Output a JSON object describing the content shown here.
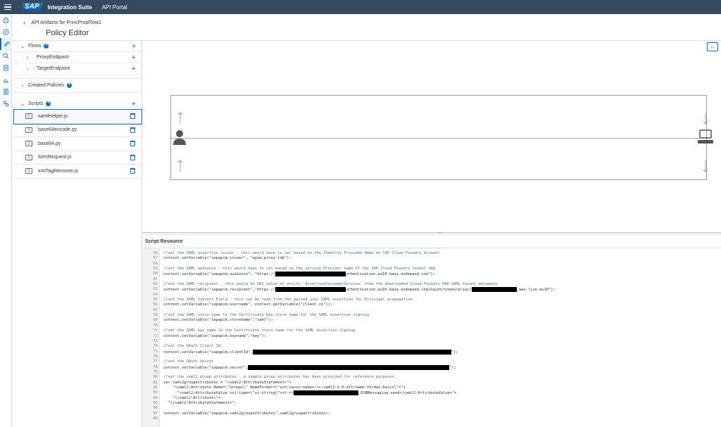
{
  "shellbar": {
    "logo": "SAP",
    "product": "Integration Suite",
    "area": "API Portal"
  },
  "leftnav": {
    "items": [
      "home-icon",
      "discover-icon",
      "design-icon",
      "test-icon",
      "configure-icon",
      "monitor-icon",
      "analyze-icon",
      "settings-icon"
    ]
  },
  "header": {
    "breadcrumb": "API Artifacts for PrincPropFlow1",
    "title": "Policy Editor"
  },
  "sidebar": {
    "flows": {
      "label": "Flows",
      "children": [
        "ProxyEndpoint",
        "TargetEndpoint"
      ]
    },
    "created_policies": {
      "label": "Created Policies"
    },
    "scripts": {
      "label": "Scripts",
      "items": [
        "samlHelper.js",
        "base64encode.py",
        "base64.py",
        "formRequest.js",
        "xmlTagRemover.js"
      ],
      "selected_index": 0
    }
  },
  "editor": {
    "title": "Script Resource",
    "lines": [
      {
        "n": "56",
        "t": "//set the SAML assertion issuer - this would have to set based on the Identity Provided Name on SAP Cloud Foundry Account",
        "c": true
      },
      {
        "n": "57",
        "t": "context.setVariable(\"sapapim.issuer\", \"apim.proxy.idp\");"
      },
      {
        "n": "58",
        "t": ""
      },
      {
        "n": "59",
        "t": "//set the SAML audience - this would have to set based on the service Provider name of the SAP Cloud Foundry tenant UAA",
        "c": true
      },
      {
        "n": "60",
        "t": "context.setVariable(\"sapapim.audience\", \"https://",
        "r": 100,
        "t2": "uthentication.eu10.hana.ondemand.com\");"
      },
      {
        "n": "61",
        "t": ""
      },
      {
        "n": "62",
        "t": "//set the SAML recipient - this would be URI value of entity 'AssertionConsumerService' from the downloaded Cloud Foundry UAA SAML tenant metadata",
        "c": true
      },
      {
        "n": "63",
        "t": "context.setVariable(\"sapapim.recipient\",\"https://",
        "r": 100,
        "t2": "uthentication.eu10.hana.ondemand.com/oauth/token/alias/",
        "r2": 64,
        "t3": ".aws-live-eu10\");"
      },
      {
        "n": "64",
        "t": ""
      },
      {
        "n": "65",
        "t": "//set the SAML Subject Field - this can be read from the passed user SAML assertion for Principal propagation",
        "c": true
      },
      {
        "n": "66",
        "t": "context.setVariable(\"sapapim.username\", context.getVariable(\"client.cn\"));"
      },
      {
        "n": "67",
        "t": ""
      },
      {
        "n": "68",
        "t": "//set the SAML store name to the Certificate Key store name for the SAML assertion signing",
        "c": true
      },
      {
        "n": "69",
        "t": "context.setVariable(\"sapapim.storename\",\"saml\");"
      },
      {
        "n": "70",
        "t": ""
      },
      {
        "n": "71",
        "t": "//set the SAML key name to the Certificate store name for the SAML assertion signing",
        "c": true
      },
      {
        "n": "72",
        "t": "context.setVariable(\"sapapim.keyname\",\"key\");"
      },
      {
        "n": "73",
        "t": ""
      },
      {
        "n": "74",
        "t": "//set the OAuth Client Id",
        "c": true
      },
      {
        "n": "75",
        "t": "context.setVariable(\"sapapim.clientId\",",
        "r": 282,
        "t2": "\");"
      },
      {
        "n": "76",
        "t": ""
      },
      {
        "n": "77",
        "t": "//set the OAuth Secret",
        "c": true
      },
      {
        "n": "78",
        "t": "context.setVariable(\"sapapim.secret\",",
        "r": 286,
        "t2": "\");"
      },
      {
        "n": "79",
        "t": ""
      },
      {
        "n": "80",
        "t": "//set the saml2 group attributes - a sample group attributes has been provided for reference purposes.",
        "c": true
      },
      {
        "n": "81",
        "t": "var saml2groupattributes = \"<saml2:AttributeStatement>\"+"
      },
      {
        "n": "82",
        "t": "    \"<saml2:Attribute Name=\\\"Groups\\\" NameFormat=\\\"urn:oasis:names:tc:saml2:2.0:attrname-format:basic\\\">\"+"
      },
      {
        "n": "83",
        "t": "      \"<saml2:AttributeValue xsi:type=\\\"xs:string\\\">it-rt",
        "r": 92,
        "t2": ".ESBMessaging.send</saml2:AttributeValue>\"+"
      },
      {
        "n": "84",
        "t": "    \"</saml2:Attribute>\"+"
      },
      {
        "n": "85",
        "t": "  \"</saml2:AttributeStatement>\";"
      },
      {
        "n": "86",
        "t": ""
      },
      {
        "n": "87",
        "t": "context.setVariable(\"sapapim.saml2groupattributes\",saml2groupattributes);"
      },
      {
        "n": "88",
        "t": ""
      }
    ]
  }
}
